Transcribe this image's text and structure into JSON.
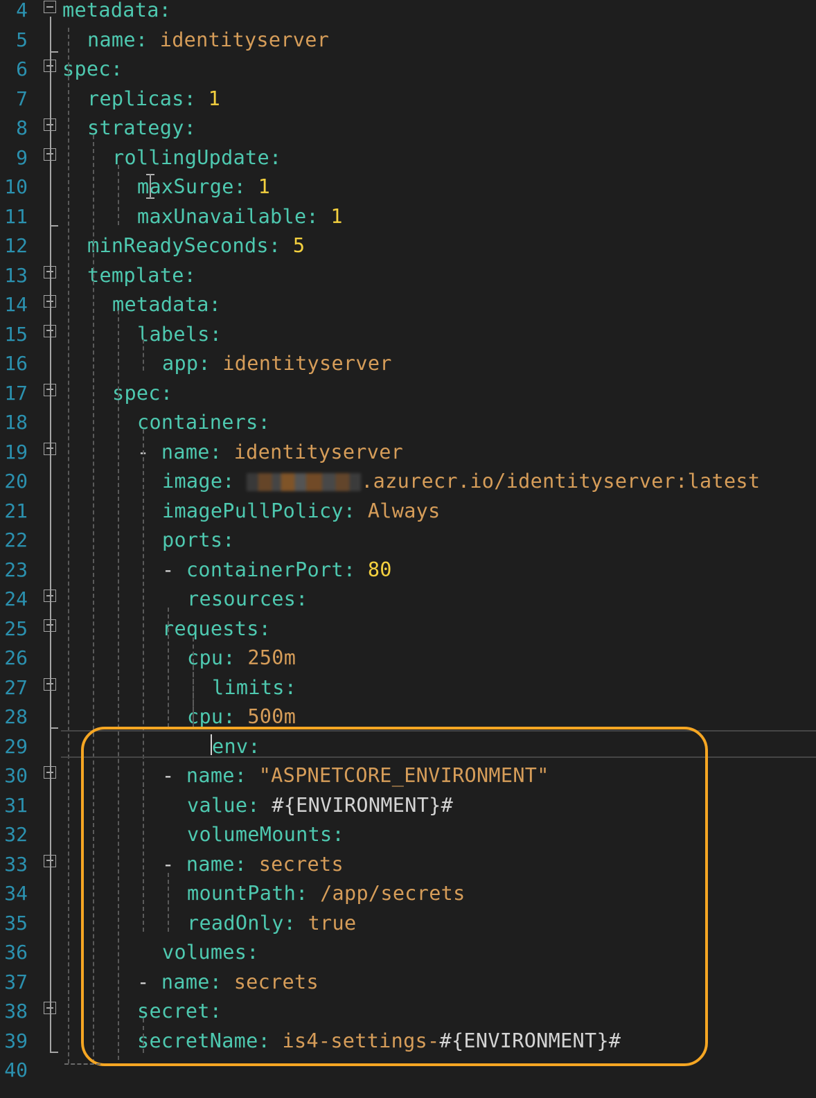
{
  "editor": {
    "lines": [
      {
        "num": "4",
        "tokens": [
          [
            "k",
            "metadata"
          ],
          [
            "p",
            ":"
          ]
        ]
      },
      {
        "num": "5",
        "tokens": [
          [
            "k",
            "name"
          ],
          [
            "p",
            ": "
          ],
          [
            "s",
            "identityserver"
          ]
        ]
      },
      {
        "num": "6",
        "tokens": [
          [
            "k",
            "spec"
          ],
          [
            "p",
            ":"
          ]
        ]
      },
      {
        "num": "7",
        "tokens": [
          [
            "k",
            "replicas"
          ],
          [
            "p",
            ": "
          ],
          [
            "n",
            "1"
          ]
        ]
      },
      {
        "num": "8",
        "tokens": [
          [
            "k",
            "strategy"
          ],
          [
            "p",
            ":"
          ]
        ]
      },
      {
        "num": "9",
        "tokens": [
          [
            "k",
            "rollingUpdate"
          ],
          [
            "p",
            ":"
          ]
        ]
      },
      {
        "num": "10",
        "tokens": [
          [
            "k",
            "maxSurge"
          ],
          [
            "p",
            ": "
          ],
          [
            "n",
            "1"
          ]
        ]
      },
      {
        "num": "11",
        "tokens": [
          [
            "k",
            "maxUnavailable"
          ],
          [
            "p",
            ": "
          ],
          [
            "n",
            "1"
          ]
        ]
      },
      {
        "num": "12",
        "tokens": [
          [
            "k",
            "minReadySeconds"
          ],
          [
            "p",
            ": "
          ],
          [
            "n",
            "5"
          ]
        ]
      },
      {
        "num": "13",
        "tokens": [
          [
            "k",
            "template"
          ],
          [
            "p",
            ":"
          ]
        ]
      },
      {
        "num": "14",
        "tokens": [
          [
            "k",
            "metadata"
          ],
          [
            "p",
            ":"
          ]
        ]
      },
      {
        "num": "15",
        "tokens": [
          [
            "k",
            "labels"
          ],
          [
            "p",
            ":"
          ]
        ]
      },
      {
        "num": "16",
        "tokens": [
          [
            "k",
            "app"
          ],
          [
            "p",
            ": "
          ],
          [
            "s",
            "identityserver"
          ]
        ]
      },
      {
        "num": "17",
        "tokens": [
          [
            "k",
            "spec"
          ],
          [
            "p",
            ":"
          ]
        ]
      },
      {
        "num": "18",
        "tokens": [
          [
            "k",
            "containers"
          ],
          [
            "p",
            ":"
          ]
        ]
      },
      {
        "num": "19",
        "tokens": [
          [
            "w",
            "- "
          ],
          [
            "k",
            "name"
          ],
          [
            "p",
            ": "
          ],
          [
            "s",
            "identityserver"
          ]
        ]
      },
      {
        "num": "20",
        "tokens": [
          [
            "k",
            "image"
          ],
          [
            "p",
            ": "
          ],
          [
            "blur",
            ""
          ],
          [
            "s",
            ".azurecr.io/identityserver:latest"
          ]
        ]
      },
      {
        "num": "21",
        "tokens": [
          [
            "k",
            "imagePullPolicy"
          ],
          [
            "p",
            ": "
          ],
          [
            "s",
            "Always"
          ]
        ]
      },
      {
        "num": "22",
        "tokens": [
          [
            "k",
            "ports"
          ],
          [
            "p",
            ":"
          ]
        ]
      },
      {
        "num": "23",
        "tokens": [
          [
            "w",
            "- "
          ],
          [
            "k",
            "containerPort"
          ],
          [
            "p",
            ": "
          ],
          [
            "n",
            "80"
          ]
        ]
      },
      {
        "num": "24",
        "tokens": [
          [
            "k",
            "resources"
          ],
          [
            "p",
            ":"
          ]
        ]
      },
      {
        "num": "25",
        "tokens": [
          [
            "k",
            "requests"
          ],
          [
            "p",
            ":"
          ]
        ]
      },
      {
        "num": "26",
        "tokens": [
          [
            "k",
            "cpu"
          ],
          [
            "p",
            ": "
          ],
          [
            "s",
            "250m"
          ]
        ]
      },
      {
        "num": "27",
        "tokens": [
          [
            "k",
            "limits"
          ],
          [
            "p",
            ":"
          ]
        ]
      },
      {
        "num": "28",
        "tokens": [
          [
            "k",
            "cpu"
          ],
          [
            "p",
            ": "
          ],
          [
            "s",
            "500m"
          ]
        ]
      },
      {
        "num": "29",
        "tokens": [
          [
            "k",
            "env"
          ],
          [
            "p",
            ":"
          ]
        ]
      },
      {
        "num": "30",
        "tokens": [
          [
            "w",
            "- "
          ],
          [
            "k",
            "name"
          ],
          [
            "p",
            ": "
          ],
          [
            "str",
            "\"ASPNETCORE_ENVIRONMENT\""
          ]
        ]
      },
      {
        "num": "31",
        "tokens": [
          [
            "k",
            "value"
          ],
          [
            "p",
            ": "
          ],
          [
            "w",
            "#{ENVIRONMENT}#"
          ]
        ]
      },
      {
        "num": "32",
        "tokens": [
          [
            "k",
            "volumeMounts"
          ],
          [
            "p",
            ":"
          ]
        ]
      },
      {
        "num": "33",
        "tokens": [
          [
            "w",
            "- "
          ],
          [
            "k",
            "name"
          ],
          [
            "p",
            ": "
          ],
          [
            "s",
            "secrets"
          ]
        ]
      },
      {
        "num": "34",
        "tokens": [
          [
            "k",
            "mountPath"
          ],
          [
            "p",
            ": "
          ],
          [
            "s",
            "/app/secrets"
          ]
        ]
      },
      {
        "num": "35",
        "tokens": [
          [
            "k",
            "readOnly"
          ],
          [
            "p",
            ": "
          ],
          [
            "s",
            "true"
          ]
        ]
      },
      {
        "num": "36",
        "tokens": [
          [
            "k",
            "volumes"
          ],
          [
            "p",
            ":"
          ]
        ]
      },
      {
        "num": "37",
        "tokens": [
          [
            "w",
            "- "
          ],
          [
            "k",
            "name"
          ],
          [
            "p",
            ": "
          ],
          [
            "s",
            "secrets"
          ]
        ]
      },
      {
        "num": "38",
        "tokens": [
          [
            "k",
            "secret"
          ],
          [
            "p",
            ":"
          ]
        ]
      },
      {
        "num": "39",
        "tokens": [
          [
            "k",
            "secretName"
          ],
          [
            "p",
            ": "
          ],
          [
            "s",
            "is4-settings-"
          ],
          [
            "w",
            "#{ENVIRONMENT}#"
          ]
        ]
      },
      {
        "num": "40",
        "tokens": []
      }
    ]
  },
  "colors": {
    "line_number": "#2b91af",
    "key": "#4ec9b0",
    "string": "#d69d59",
    "number": "#f4d03f",
    "plain": "#d4d4d4",
    "background": "#1e1e1e",
    "highlight_box": "#f5a623"
  },
  "icons": {
    "fold_marker": "collapse-minus-icon",
    "text_cursor": "ibeam-cursor-icon"
  }
}
